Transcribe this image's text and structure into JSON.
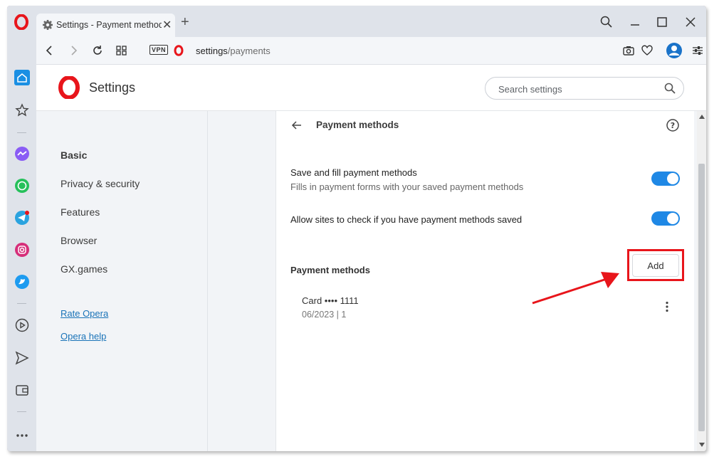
{
  "browser": {
    "tab_title": "Settings - Payment methods",
    "url_host": "settings",
    "url_path": "/payments",
    "vpn_label": "VPN",
    "colors": {
      "chrome": "#dfe3ea",
      "accent": "#1f88e5",
      "brand_red": "#e8151b"
    }
  },
  "settings": {
    "title": "Settings",
    "search_placeholder": "Search settings",
    "nav": [
      {
        "label": "Basic",
        "active": true
      },
      {
        "label": "Privacy & security",
        "active": false
      },
      {
        "label": "Features",
        "active": false
      },
      {
        "label": "Browser",
        "active": false
      },
      {
        "label": "GX.games",
        "active": false
      }
    ],
    "links": [
      "Rate Opera",
      "Opera help"
    ]
  },
  "payments": {
    "page_title": "Payment methods",
    "save_fill": {
      "title": "Save and fill payment methods",
      "subtitle": "Fills in payment forms with your saved payment methods",
      "enabled": true
    },
    "allow_check": {
      "title": "Allow sites to check if you have payment methods saved",
      "enabled": true
    },
    "section_title": "Payment methods",
    "add_label": "Add",
    "cards": [
      {
        "name": "Card •••• 1111",
        "expiry": "06/2023 | 1"
      }
    ]
  }
}
